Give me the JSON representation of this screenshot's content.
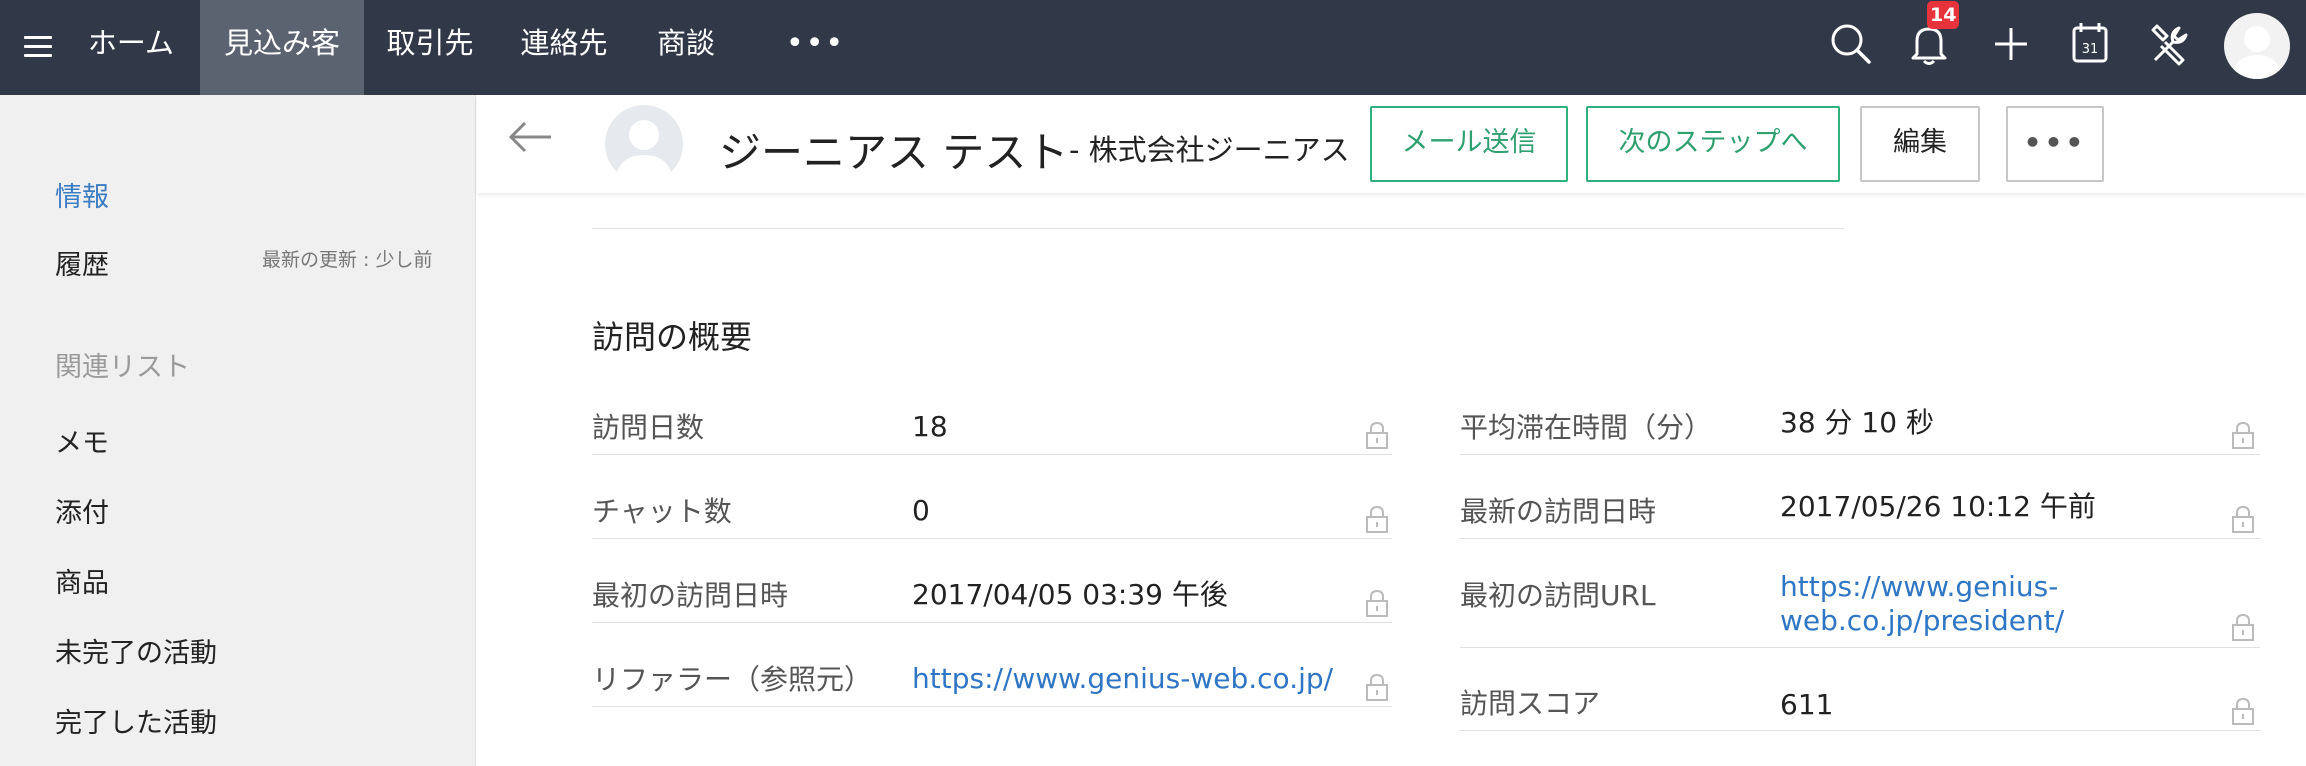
{
  "topnav": {
    "tabs": [
      "ホーム",
      "見込み客",
      "取引先",
      "連絡先",
      "商談"
    ],
    "active_tab": "見込み客",
    "more": "•••",
    "notification_count": "14",
    "calendar_day": "31",
    "icons": [
      "menu-icon",
      "search-icon",
      "bell-icon",
      "plus-icon",
      "calendar-icon",
      "tools-icon",
      "avatar"
    ]
  },
  "sidebar": {
    "info": "情報",
    "history": "履歴",
    "updated": "最新の更新 : 少し前",
    "related_heading": "関連リスト",
    "related": [
      "メモ",
      "添付",
      "商品",
      "未完了の活動",
      "完了した活動"
    ]
  },
  "record": {
    "name": "ジーニアス テスト",
    "company": "- 株式会社ジーニアス",
    "buttons": {
      "send_mail": "メール送信",
      "next_step": "次のステップへ",
      "edit": "編集",
      "more": "•••"
    }
  },
  "visit_summary": {
    "title": "訪問の概要",
    "left": [
      {
        "label": "訪問日数",
        "value": "18",
        "link": false
      },
      {
        "label": "チャット数",
        "value": "0",
        "link": false
      },
      {
        "label": "最初の訪問日時",
        "value": "2017/04/05 03:39 午後",
        "link": false
      },
      {
        "label": "リファラー（参照元）",
        "value": "https://www.genius-web.co.jp/",
        "link": true
      }
    ],
    "right": [
      {
        "label": "平均滞在時間（分）",
        "value": "38 分 10 秒",
        "link": false
      },
      {
        "label": "最新の訪問日時",
        "value": "2017/05/26 10:12 午前",
        "link": false
      },
      {
        "label": "最初の訪問URL",
        "value_line1": "https://www.genius-",
        "value_line2": "web.co.jp/president/",
        "link": true
      },
      {
        "label": "訪問スコア",
        "value": "611",
        "link": false
      }
    ]
  },
  "colors": {
    "topbar": "#313949",
    "active_tab": "#5b6371",
    "accent_green": "#2fb07d",
    "link_blue": "#2f76c4",
    "badge_red": "#e7333b"
  }
}
